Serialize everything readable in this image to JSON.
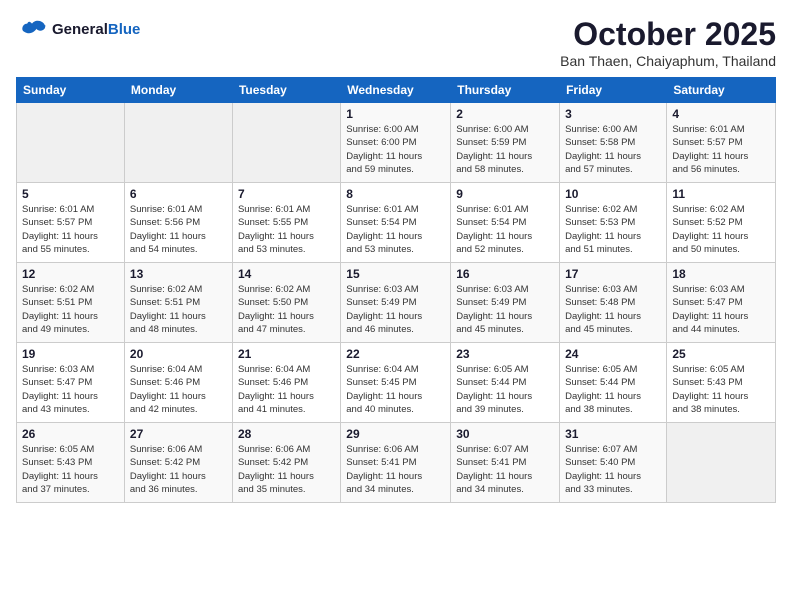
{
  "header": {
    "logo_general": "General",
    "logo_blue": "Blue",
    "month": "October 2025",
    "location": "Ban Thaen, Chaiyaphum, Thailand"
  },
  "days_of_week": [
    "Sunday",
    "Monday",
    "Tuesday",
    "Wednesday",
    "Thursday",
    "Friday",
    "Saturday"
  ],
  "weeks": [
    [
      {
        "day": "",
        "info": ""
      },
      {
        "day": "",
        "info": ""
      },
      {
        "day": "",
        "info": ""
      },
      {
        "day": "1",
        "info": "Sunrise: 6:00 AM\nSunset: 6:00 PM\nDaylight: 11 hours\nand 59 minutes."
      },
      {
        "day": "2",
        "info": "Sunrise: 6:00 AM\nSunset: 5:59 PM\nDaylight: 11 hours\nand 58 minutes."
      },
      {
        "day": "3",
        "info": "Sunrise: 6:00 AM\nSunset: 5:58 PM\nDaylight: 11 hours\nand 57 minutes."
      },
      {
        "day": "4",
        "info": "Sunrise: 6:01 AM\nSunset: 5:57 PM\nDaylight: 11 hours\nand 56 minutes."
      }
    ],
    [
      {
        "day": "5",
        "info": "Sunrise: 6:01 AM\nSunset: 5:57 PM\nDaylight: 11 hours\nand 55 minutes."
      },
      {
        "day": "6",
        "info": "Sunrise: 6:01 AM\nSunset: 5:56 PM\nDaylight: 11 hours\nand 54 minutes."
      },
      {
        "day": "7",
        "info": "Sunrise: 6:01 AM\nSunset: 5:55 PM\nDaylight: 11 hours\nand 53 minutes."
      },
      {
        "day": "8",
        "info": "Sunrise: 6:01 AM\nSunset: 5:54 PM\nDaylight: 11 hours\nand 53 minutes."
      },
      {
        "day": "9",
        "info": "Sunrise: 6:01 AM\nSunset: 5:54 PM\nDaylight: 11 hours\nand 52 minutes."
      },
      {
        "day": "10",
        "info": "Sunrise: 6:02 AM\nSunset: 5:53 PM\nDaylight: 11 hours\nand 51 minutes."
      },
      {
        "day": "11",
        "info": "Sunrise: 6:02 AM\nSunset: 5:52 PM\nDaylight: 11 hours\nand 50 minutes."
      }
    ],
    [
      {
        "day": "12",
        "info": "Sunrise: 6:02 AM\nSunset: 5:51 PM\nDaylight: 11 hours\nand 49 minutes."
      },
      {
        "day": "13",
        "info": "Sunrise: 6:02 AM\nSunset: 5:51 PM\nDaylight: 11 hours\nand 48 minutes."
      },
      {
        "day": "14",
        "info": "Sunrise: 6:02 AM\nSunset: 5:50 PM\nDaylight: 11 hours\nand 47 minutes."
      },
      {
        "day": "15",
        "info": "Sunrise: 6:03 AM\nSunset: 5:49 PM\nDaylight: 11 hours\nand 46 minutes."
      },
      {
        "day": "16",
        "info": "Sunrise: 6:03 AM\nSunset: 5:49 PM\nDaylight: 11 hours\nand 45 minutes."
      },
      {
        "day": "17",
        "info": "Sunrise: 6:03 AM\nSunset: 5:48 PM\nDaylight: 11 hours\nand 45 minutes."
      },
      {
        "day": "18",
        "info": "Sunrise: 6:03 AM\nSunset: 5:47 PM\nDaylight: 11 hours\nand 44 minutes."
      }
    ],
    [
      {
        "day": "19",
        "info": "Sunrise: 6:03 AM\nSunset: 5:47 PM\nDaylight: 11 hours\nand 43 minutes."
      },
      {
        "day": "20",
        "info": "Sunrise: 6:04 AM\nSunset: 5:46 PM\nDaylight: 11 hours\nand 42 minutes."
      },
      {
        "day": "21",
        "info": "Sunrise: 6:04 AM\nSunset: 5:46 PM\nDaylight: 11 hours\nand 41 minutes."
      },
      {
        "day": "22",
        "info": "Sunrise: 6:04 AM\nSunset: 5:45 PM\nDaylight: 11 hours\nand 40 minutes."
      },
      {
        "day": "23",
        "info": "Sunrise: 6:05 AM\nSunset: 5:44 PM\nDaylight: 11 hours\nand 39 minutes."
      },
      {
        "day": "24",
        "info": "Sunrise: 6:05 AM\nSunset: 5:44 PM\nDaylight: 11 hours\nand 38 minutes."
      },
      {
        "day": "25",
        "info": "Sunrise: 6:05 AM\nSunset: 5:43 PM\nDaylight: 11 hours\nand 38 minutes."
      }
    ],
    [
      {
        "day": "26",
        "info": "Sunrise: 6:05 AM\nSunset: 5:43 PM\nDaylight: 11 hours\nand 37 minutes."
      },
      {
        "day": "27",
        "info": "Sunrise: 6:06 AM\nSunset: 5:42 PM\nDaylight: 11 hours\nand 36 minutes."
      },
      {
        "day": "28",
        "info": "Sunrise: 6:06 AM\nSunset: 5:42 PM\nDaylight: 11 hours\nand 35 minutes."
      },
      {
        "day": "29",
        "info": "Sunrise: 6:06 AM\nSunset: 5:41 PM\nDaylight: 11 hours\nand 34 minutes."
      },
      {
        "day": "30",
        "info": "Sunrise: 6:07 AM\nSunset: 5:41 PM\nDaylight: 11 hours\nand 34 minutes."
      },
      {
        "day": "31",
        "info": "Sunrise: 6:07 AM\nSunset: 5:40 PM\nDaylight: 11 hours\nand 33 minutes."
      },
      {
        "day": "",
        "info": ""
      }
    ]
  ]
}
